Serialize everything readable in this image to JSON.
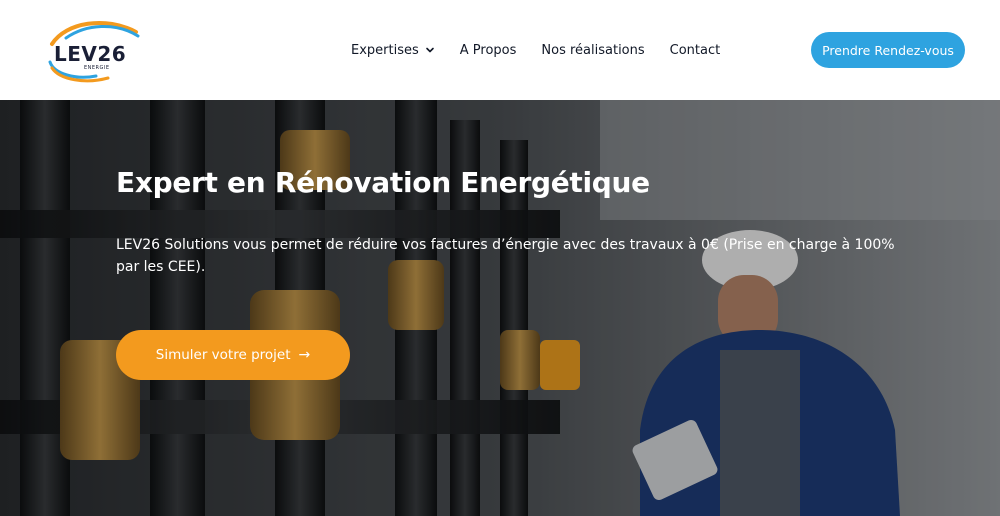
{
  "header": {
    "logo": {
      "text": "LEV26",
      "sub": "ENERGIE"
    },
    "nav": [
      {
        "label": "Expertises",
        "icon": "chevron-down-icon"
      },
      {
        "label": "A Propos"
      },
      {
        "label": "Nos réalisations"
      },
      {
        "label": "Contact"
      }
    ],
    "cta_label": "Prendre Rendez-vous"
  },
  "hero": {
    "title": "Expert en Rénovation Energétique",
    "text": "LEV26 Solutions vous permet de réduire vos factures d’énergie avec des travaux à 0€ (Prise en charge à 100% par les CEE).",
    "cta_label": "Simuler votre projet",
    "cta_icon": "arrow-right-icon",
    "image": "technician-with-thermometer-and-pipes"
  },
  "colors": {
    "accent_blue": "#2ea3e0",
    "accent_orange": "#f39a1e",
    "text_dark": "#111827"
  }
}
